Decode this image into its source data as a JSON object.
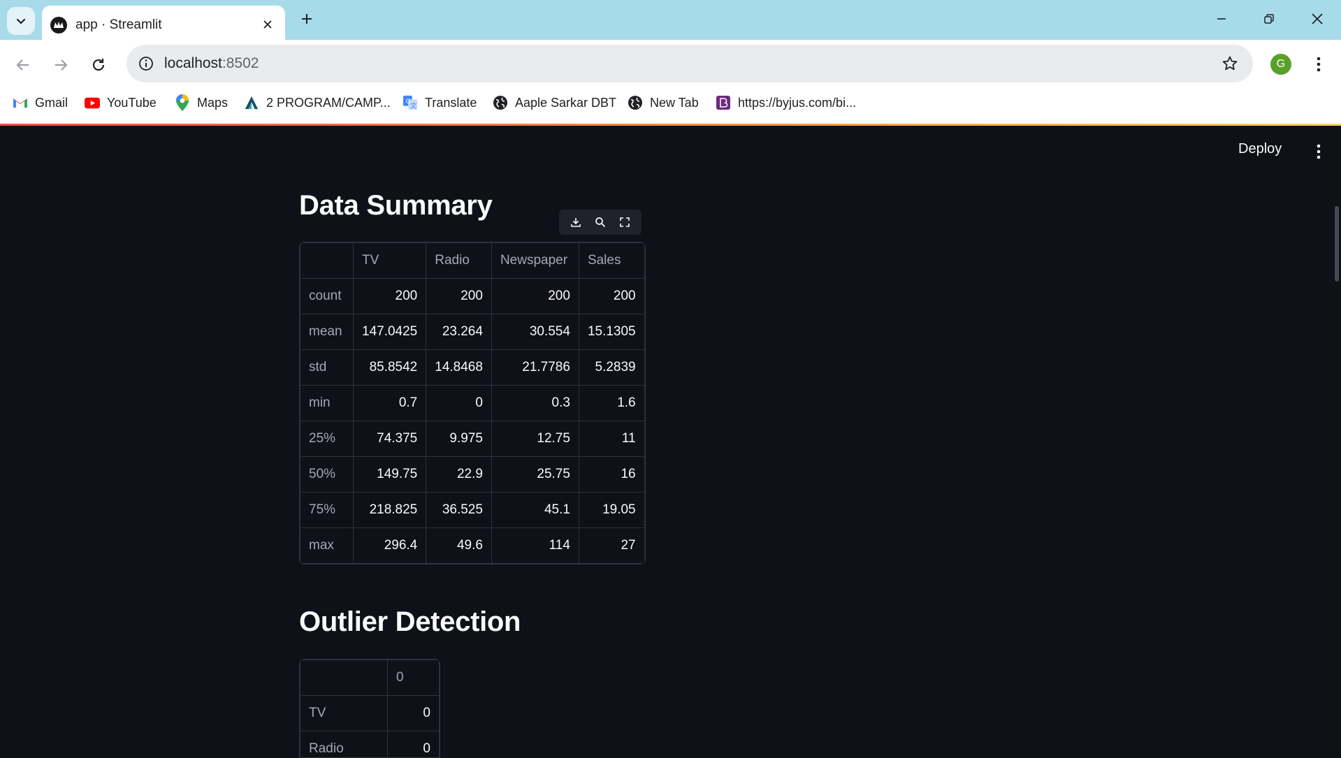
{
  "browser": {
    "tab_title": "app · Streamlit",
    "url_host": "localhost",
    "url_port": ":8502",
    "profile_initial": "G",
    "bookmarks": [
      {
        "label": "Gmail",
        "icon": "gmail-icon"
      },
      {
        "label": "YouTube",
        "icon": "youtube-icon"
      },
      {
        "label": "Maps",
        "icon": "maps-icon"
      },
      {
        "label": "2 PROGRAM/CAMP...",
        "icon": "program-icon"
      },
      {
        "label": "Translate",
        "icon": "translate-icon"
      },
      {
        "label": "Aaple Sarkar DBT",
        "icon": "globe-icon"
      },
      {
        "label": "New Tab",
        "icon": "globe-icon"
      },
      {
        "label": "https://byjus.com/bi...",
        "icon": "byjus-icon"
      }
    ]
  },
  "app": {
    "deploy_label": "Deploy",
    "summary": {
      "title": "Data Summary",
      "columns": [
        "",
        "TV",
        "Radio",
        "Newspaper",
        "Sales"
      ],
      "rows": [
        [
          "count",
          "200",
          "200",
          "200",
          "200"
        ],
        [
          "mean",
          "147.0425",
          "23.264",
          "30.554",
          "15.1305"
        ],
        [
          "std",
          "85.8542",
          "14.8468",
          "21.7786",
          "5.2839"
        ],
        [
          "min",
          "0.7",
          "0",
          "0.3",
          "1.6"
        ],
        [
          "25%",
          "74.375",
          "9.975",
          "12.75",
          "11"
        ],
        [
          "50%",
          "149.75",
          "22.9",
          "25.75",
          "16"
        ],
        [
          "75%",
          "218.825",
          "36.525",
          "45.1",
          "19.05"
        ],
        [
          "max",
          "296.4",
          "49.6",
          "114",
          "27"
        ]
      ]
    },
    "outliers": {
      "title": "Outlier Detection",
      "columns": [
        "",
        "0"
      ],
      "rows": [
        [
          "TV",
          "0"
        ],
        [
          "Radio",
          "0"
        ]
      ]
    }
  }
}
